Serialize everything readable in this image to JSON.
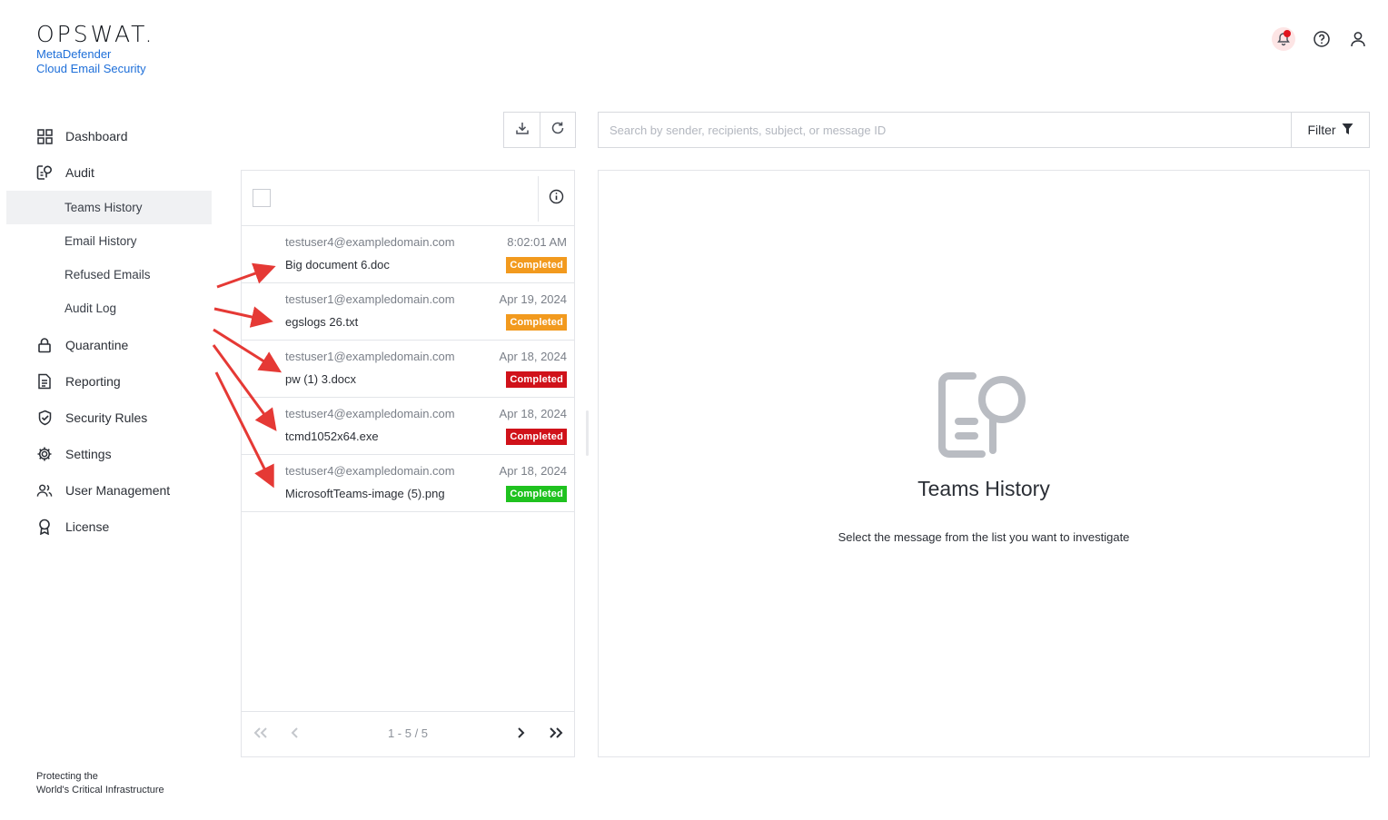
{
  "brand": {
    "logo": "OPSWAT.",
    "product_line1": "MetaDefender",
    "product_line2": "Cloud Email Security"
  },
  "top_icons": [
    "bell-icon",
    "help-icon",
    "user-icon"
  ],
  "sidebar": {
    "items": [
      {
        "label": "Dashboard",
        "icon": "dashboard-icon"
      },
      {
        "label": "Audit",
        "icon": "audit-icon"
      },
      {
        "label": "Quarantine",
        "icon": "lock-icon"
      },
      {
        "label": "Reporting",
        "icon": "report-icon"
      },
      {
        "label": "Security Rules",
        "icon": "shield-check-icon"
      },
      {
        "label": "Settings",
        "icon": "gear-icon"
      },
      {
        "label": "User Management",
        "icon": "users-icon"
      },
      {
        "label": "License",
        "icon": "award-icon"
      }
    ],
    "audit_sub": [
      {
        "label": "Teams History",
        "active": true
      },
      {
        "label": "Email History"
      },
      {
        "label": "Refused Emails"
      },
      {
        "label": "Audit Log"
      }
    ],
    "footer_line1": "Protecting the",
    "footer_line2": "World's Critical Infrastructure"
  },
  "search": {
    "placeholder": "Search by sender, recipients, subject, or message ID",
    "filter_label": "Filter"
  },
  "list": {
    "rows": [
      {
        "sender": "testuser4@exampledomain.com",
        "date": "8:02:01 AM",
        "file": "Big document 6.doc",
        "status": "Completed",
        "status_color": "#f29a1e"
      },
      {
        "sender": "testuser1@exampledomain.com",
        "date": "Apr 19, 2024",
        "file": "egslogs 26.txt",
        "status": "Completed",
        "status_color": "#f29a1e"
      },
      {
        "sender": "testuser1@exampledomain.com",
        "date": "Apr 18, 2024",
        "file": "pw (1) 3.docx",
        "status": "Completed",
        "status_color": "#d0121a"
      },
      {
        "sender": "testuser4@exampledomain.com",
        "date": "Apr 18, 2024",
        "file": "tcmd1052x64.exe",
        "status": "Completed",
        "status_color": "#d0121a"
      },
      {
        "sender": "testuser4@exampledomain.com",
        "date": "Apr 18, 2024",
        "file": "MicrosoftTeams-image (5).png",
        "status": "Completed",
        "status_color": "#1fc21f"
      }
    ],
    "pagination": "1 - 5 / 5"
  },
  "detail": {
    "title": "Teams History",
    "subtitle": "Select the message from the list you want to investigate"
  },
  "colors": {
    "accent": "#1e6fd9",
    "annotation_arrow": "#e53935"
  }
}
